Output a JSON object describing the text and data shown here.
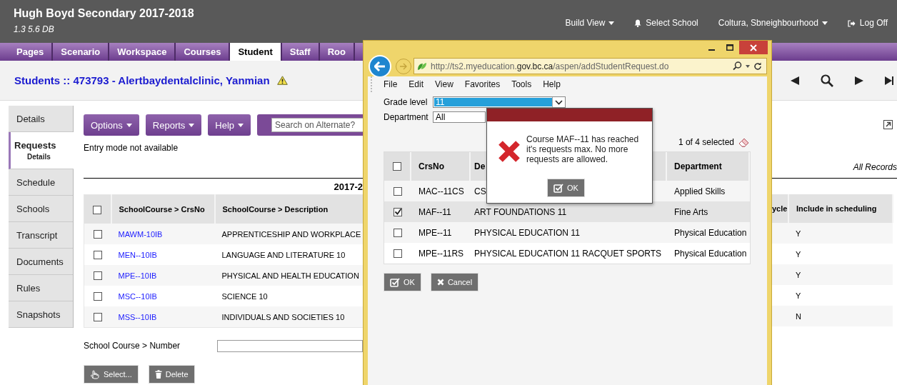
{
  "app_header": {
    "title": "Hugh Boyd Secondary 2017-2018",
    "version": "1.3 5.6 DB",
    "menu": [
      {
        "label": "Build View",
        "kind": "dropdown"
      },
      {
        "label": "Select School",
        "kind": "bell"
      },
      {
        "label": "Coltura, Sbneighbourhood",
        "kind": "dropdown"
      },
      {
        "label": "Log Off",
        "kind": "logout"
      }
    ]
  },
  "tabs": [
    {
      "label": "Pages",
      "selected": false
    },
    {
      "label": "Scenario",
      "selected": false
    },
    {
      "label": "Workspace",
      "selected": false
    },
    {
      "label": "Courses",
      "selected": false
    },
    {
      "label": "Student",
      "selected": true
    },
    {
      "label": "Staff",
      "selected": false
    },
    {
      "label": "Roo",
      "selected": false
    }
  ],
  "page_title": "Students :: 473793 - Alertbaydentalclinic, Yanmian",
  "side_nav": [
    {
      "label": "Details",
      "selected": false
    },
    {
      "label": "Requests",
      "sublabel": "Details",
      "selected": true
    },
    {
      "label": "Schedule",
      "selected": false
    },
    {
      "label": "Schools",
      "selected": false
    },
    {
      "label": "Transcript",
      "selected": false
    },
    {
      "label": "Documents",
      "selected": false
    },
    {
      "label": "Rules",
      "selected": false
    },
    {
      "label": "Snapshots",
      "selected": false
    }
  ],
  "toolbar": {
    "buttons": [
      "Options",
      "Reports",
      "Help"
    ],
    "search": {
      "placeholder": "Search on Alternate?"
    }
  },
  "entry_mode": "Entry mode not available",
  "year_heading": "2017-2",
  "records_filter": "All Records",
  "requests_table": {
    "select_all_checked": false,
    "columns": [
      "SchoolCourse > CrsNo",
      "SchoolCourse > Description",
      "ycle",
      "Include in scheduling"
    ],
    "rows": [
      {
        "checked": false,
        "crsno": "MAWM-10IB",
        "description": "APPRENTICESHIP AND WORKPLACE",
        "include": "Y"
      },
      {
        "checked": false,
        "crsno": "MEN--10IB",
        "description": "LANGUAGE AND LITERATURE 10",
        "include": "Y"
      },
      {
        "checked": false,
        "crsno": "MPE--10IB",
        "description": "PHYSICAL AND HEALTH EDUCATION",
        "include": "Y"
      },
      {
        "checked": false,
        "crsno": "MSC--10IB",
        "description": "SCIENCE 10",
        "include": "Y"
      },
      {
        "checked": false,
        "crsno": "MSS--10IB",
        "description": "INDIVIDUALS AND SOCIETIES 10",
        "include": "N"
      }
    ]
  },
  "number_field": {
    "label": "School Course > Number"
  },
  "action_buttons": [
    {
      "label": "Select...",
      "kind": "select"
    },
    {
      "label": "Delete",
      "kind": "delete"
    }
  ],
  "popup_window": {
    "url": "http://ts2.myeducation.**gov.bc.ca**/aspen/addStudentRequest.do",
    "menu": [
      "File",
      "Edit",
      "View",
      "Favorites",
      "Tools",
      "Help"
    ],
    "grade_level": {
      "label": "Grade level",
      "value": "11"
    },
    "department": {
      "label": "Department",
      "value": "All"
    },
    "selection_count": "1 of 4 selected",
    "table": {
      "select_all_checked": false,
      "columns": [
        "CrsNo",
        "De",
        "Department"
      ],
      "rows": [
        {
          "checked": false,
          "crsno": "MAC--11CS",
          "description": "CS",
          "department": "Applied Skills"
        },
        {
          "checked": true,
          "crsno": "MAF--11",
          "description": "ART FOUNDATIONS 11",
          "department": "Fine Arts"
        },
        {
          "checked": false,
          "crsno": "MPE--11",
          "description": "PHYSICAL EDUCATION 11",
          "department": "Physical Education"
        },
        {
          "checked": false,
          "crsno": "MPE--11RS",
          "description": "PHYSICAL EDUCATION 11 RACQUET SPORTS",
          "department": "Physical Education"
        }
      ]
    },
    "buttons": [
      {
        "label": "OK",
        "kind": "ok"
      },
      {
        "label": "Cancel",
        "kind": "cancel"
      }
    ]
  },
  "alert": {
    "message": "Course MAF--11 has reached it's requests max. No more requests are allowed.",
    "button": "OK"
  }
}
